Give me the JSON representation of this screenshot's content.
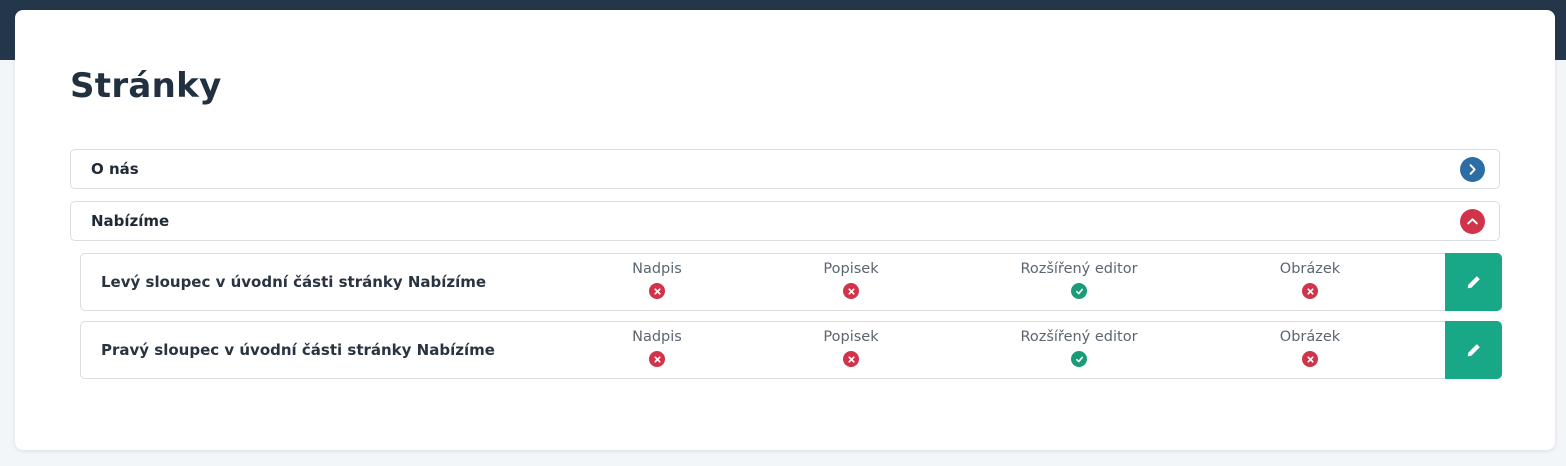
{
  "page": {
    "title": "Stránky"
  },
  "accordions": [
    {
      "label": "O nás",
      "state": "collapsed",
      "toggle_color": "#2c6ea3",
      "toggle_icon": "chevron-right-icon"
    },
    {
      "label": "Nabízíme",
      "state": "expanded",
      "toggle_color": "#d0334a",
      "toggle_icon": "chevron-up-icon"
    }
  ],
  "rows": [
    {
      "title": "Levý sloupec v úvodní části stránky Nabízíme",
      "fields": [
        {
          "label": "Nadpis",
          "status": "no"
        },
        {
          "label": "Popisek",
          "status": "no"
        },
        {
          "label": "Rozšířený editor",
          "status": "yes"
        },
        {
          "label": "Obrázek",
          "status": "no"
        }
      ],
      "edit_icon": "pencil-icon"
    },
    {
      "title": "Pravý sloupec v úvodní části stránky Nabízíme",
      "fields": [
        {
          "label": "Nadpis",
          "status": "no"
        },
        {
          "label": "Popisek",
          "status": "no"
        },
        {
          "label": "Rozšířený editor",
          "status": "yes"
        },
        {
          "label": "Obrázek",
          "status": "no"
        }
      ],
      "edit_icon": "pencil-icon"
    }
  ],
  "colors": {
    "topbar": "#24364a",
    "status_no": "#d0334a",
    "status_yes": "#1a9c7b",
    "edit_button": "#18a888"
  }
}
